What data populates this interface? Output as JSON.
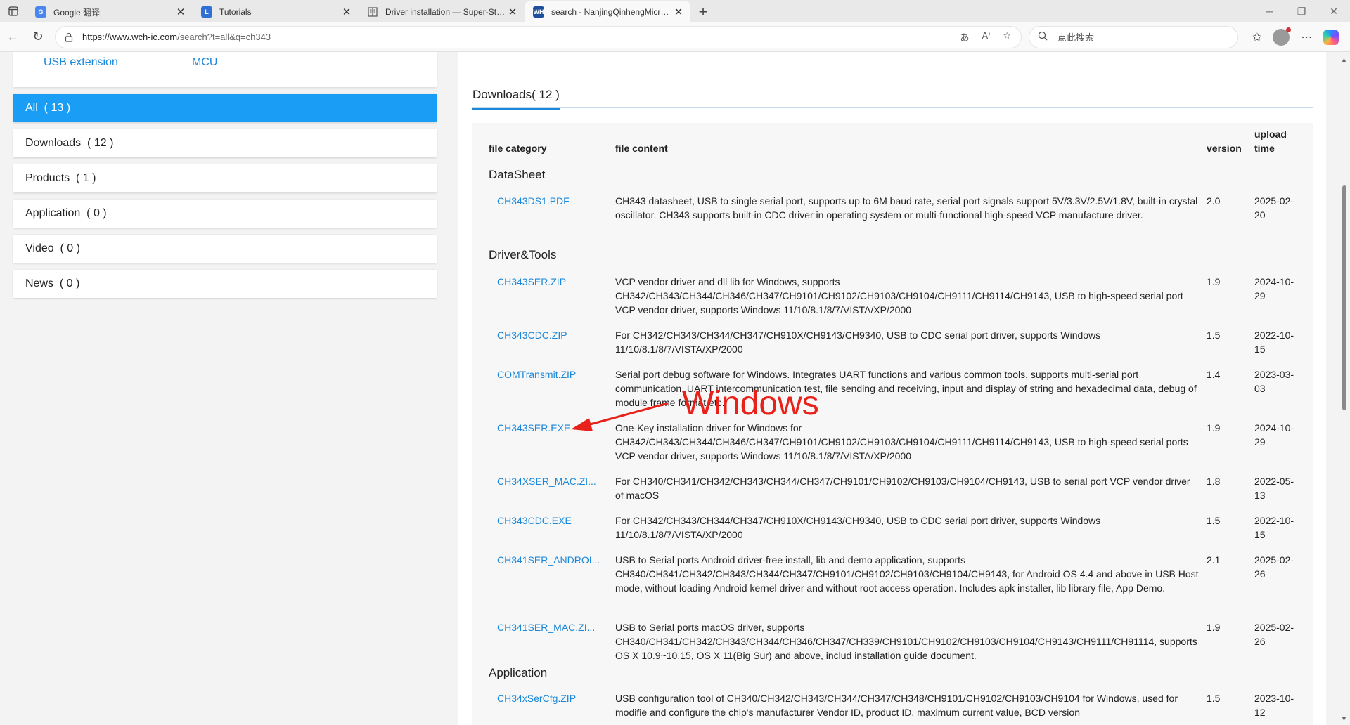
{
  "browser": {
    "tabs": [
      {
        "title": "Google 翻译",
        "icon": "google-translate-icon",
        "active": false
      },
      {
        "title": "Tutorials",
        "icon": "tutorials-icon",
        "active": false
      },
      {
        "title": "Driver installation — Super-Starte",
        "icon": "reader-icon",
        "active": false
      },
      {
        "title": "search - NanjingQinhengMicroele",
        "icon": "wch-icon",
        "active": true
      }
    ],
    "url_host": "https://www.wch-ic.com",
    "url_path": "/search?t=all&q=ch343",
    "search_placeholder": "点此搜索"
  },
  "sidebar": {
    "top_links": [
      "USB extension",
      "MCU"
    ],
    "filters": [
      {
        "label": "All",
        "count": "( 13 )",
        "active": true
      },
      {
        "label": "Downloads",
        "count": "( 12 )",
        "active": false
      },
      {
        "label": "Products",
        "count": "( 1 )",
        "active": false
      },
      {
        "label": "Application",
        "count": "( 0 )",
        "active": false
      },
      {
        "label": "Video",
        "count": "( 0 )",
        "active": false
      },
      {
        "label": "News",
        "count": "( 0 )",
        "active": false
      }
    ]
  },
  "downloads": {
    "heading": "Downloads( 12 )",
    "columns": {
      "category": "file category",
      "content": "file content",
      "version": "version",
      "upload_line1": "upload",
      "upload_line2": "time"
    },
    "sections": [
      {
        "name": "DataSheet",
        "rows": [
          {
            "file": "CH343DS1.PDF",
            "desc": "CH343 datasheet, USB to single serial port, supports up to 6M baud rate, serial port signals support 5V/3.3V/2.5V/1.8V, built-in crystal oscillator. CH343 supports built-in CDC driver in operating system or multi-functional high-speed VCP manufacture driver.",
            "version": "2.0",
            "date": "2025-02-20"
          }
        ]
      },
      {
        "name": "Driver&Tools",
        "rows": [
          {
            "file": "CH343SER.ZIP",
            "desc": "VCP vendor driver and dll lib for Windows, supports CH342/CH343/CH344/CH346/CH347/CH9101/CH9102/CH9103/CH9104/CH9111/CH9114/CH9143, USB to high-speed serial port VCP vendor driver, supports Windows 11/10/8.1/8/7/VISTA/XP/2000",
            "version": "1.9",
            "date": "2024-10-29"
          },
          {
            "file": "CH343CDC.ZIP",
            "desc": "For CH342/CH343/CH344/CH347/CH910X/CH9143/CH9340, USB to CDC serial port driver, supports Windows 11/10/8.1/8/7/VISTA/XP/2000",
            "version": "1.5",
            "date": "2022-10-15"
          },
          {
            "file": "COMTransmit.ZIP",
            "desc": "Serial port debug software for Windows. Integrates UART functions and various common tools, supports multi-serial port communication, UART intercommunication test, file sending and receiving, input and display of string and hexadecimal data, debug of module frame format etc.",
            "version": "1.4",
            "date": "2023-03-03"
          },
          {
            "file": "CH343SER.EXE",
            "desc": "One-Key installation driver for Windows for CH342/CH343/CH344/CH346/CH347/CH9101/CH9102/CH9103/CH9104/CH9111/CH9114/CH9143, USB to high-speed serial ports VCP vendor driver, supports Windows 11/10/8.1/8/7/VISTA/XP/2000",
            "version": "1.9",
            "date": "2024-10-29"
          },
          {
            "file": "CH34XSER_MAC.ZI...",
            "desc": "For CH340/CH341/CH342/CH343/CH344/CH347/CH9101/CH9102/CH9103/CH9104/CH9143, USB to serial port VCP vendor driver of macOS",
            "version": "1.8",
            "date": "2022-05-13"
          },
          {
            "file": "CH343CDC.EXE",
            "desc": "For CH342/CH343/CH344/CH347/CH910X/CH9143/CH9340, USB to CDC serial port driver, supports Windows 11/10/8.1/8/7/VISTA/XP/2000",
            "version": "1.5",
            "date": "2022-10-15"
          },
          {
            "file": "CH341SER_ANDROI...",
            "desc": "USB to Serial ports Android driver-free install, lib and demo application, supports CH340/CH341/CH342/CH343/CH344/CH347/CH9101/CH9102/CH9103/CH9104/CH9143, for Android OS 4.4 and above in USB Host mode, without loading Android kernel driver and without root access operation. Includes apk installer, lib library file, App Demo.",
            "version": "2.1",
            "date": "2025-02-26"
          },
          {
            "file": "CH341SER_MAC.ZI...",
            "desc": "USB to Serial ports macOS driver, supports CH340/CH341/CH342/CH343/CH344/CH346/CH347/CH339/CH9101/CH9102/CH9103/CH9104/CH9143/CH9111/CH91114, supports OS X 10.9~10.15, OS X 11(Big Sur) and above, includ installation guide document.",
            "version": "1.9",
            "date": "2025-02-26"
          }
        ]
      },
      {
        "name": "Application",
        "rows": [
          {
            "file": "CH34xSerCfg.ZIP",
            "desc": "USB configuration tool of CH340/CH342/CH343/CH344/CH347/CH348/CH9101/CH9102/CH9103/CH9104 for Windows, used for modifie and configure the chip's manufacturer Vendor ID, product ID, maximum current value, BCD version",
            "version": "1.5",
            "date": "2023-10-12"
          }
        ]
      }
    ]
  },
  "annotation": {
    "label": "Windows",
    "color": "#e8221b"
  }
}
